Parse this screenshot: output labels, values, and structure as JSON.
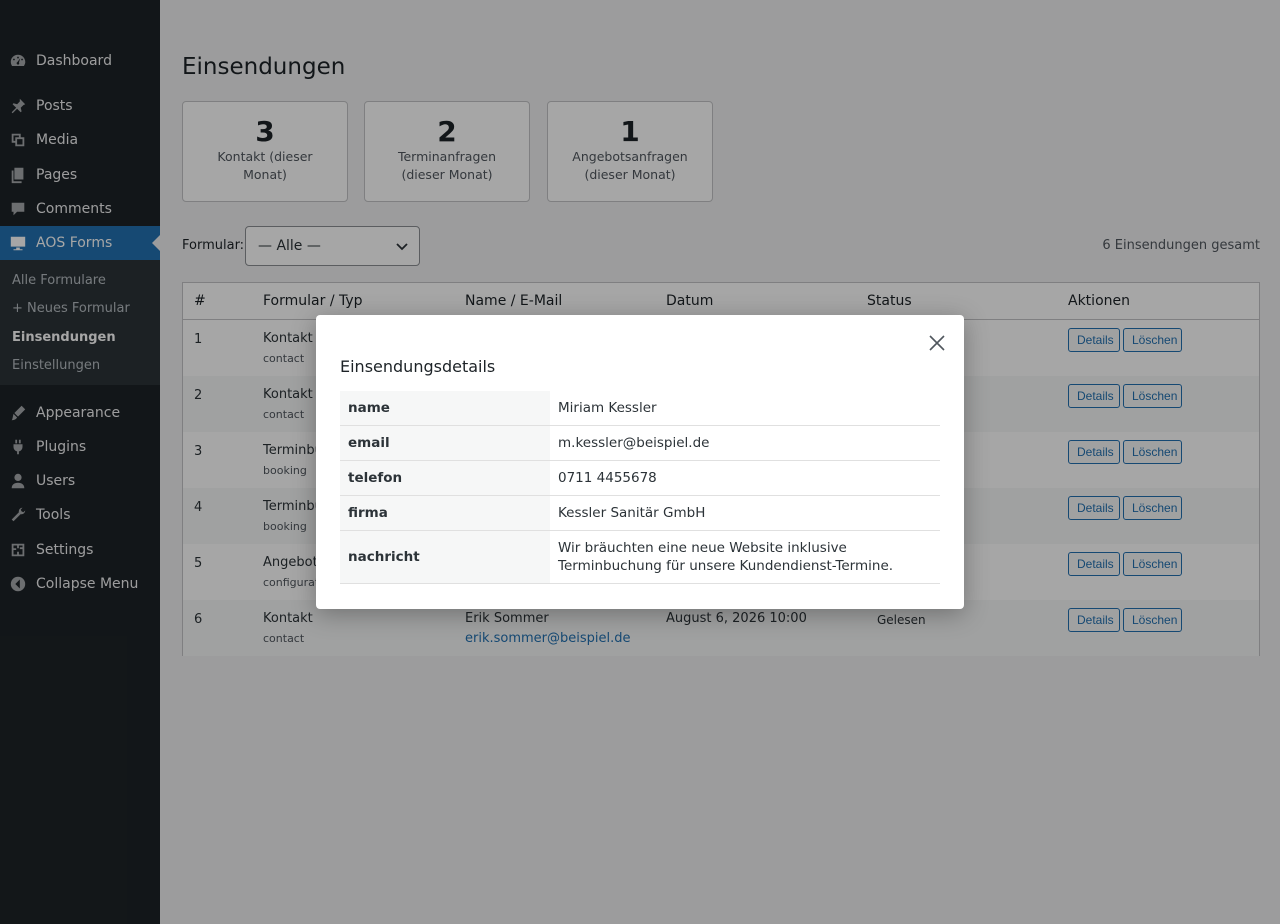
{
  "sidebar": {
    "items": [
      {
        "label": "Dashboard",
        "icon": "dashboard-icon"
      },
      {
        "label": "Posts",
        "icon": "pin-icon"
      },
      {
        "label": "Media",
        "icon": "media-icon"
      },
      {
        "label": "Pages",
        "icon": "pages-icon"
      },
      {
        "label": "Comments",
        "icon": "comments-icon"
      },
      {
        "label": "AOS Forms",
        "icon": "forms-icon"
      },
      {
        "label": "Appearance",
        "icon": "appearance-icon"
      },
      {
        "label": "Plugins",
        "icon": "plugins-icon"
      },
      {
        "label": "Users",
        "icon": "users-icon"
      },
      {
        "label": "Tools",
        "icon": "tools-icon"
      },
      {
        "label": "Settings",
        "icon": "settings-icon"
      },
      {
        "label": "Collapse Menu",
        "icon": "collapse-icon"
      }
    ],
    "submenu": [
      {
        "label": "Alle Formulare"
      },
      {
        "label": "+ Neues Formular"
      },
      {
        "label": "Einsendungen"
      },
      {
        "label": "Einstellungen"
      }
    ]
  },
  "page": {
    "title": "Einsendungen",
    "stats": [
      {
        "value": "3",
        "label": "Kontakt (dieser Monat)"
      },
      {
        "value": "2",
        "label": "Terminanfragen (dieser Monat)"
      },
      {
        "value": "1",
        "label": "Angebotsanfragen (dieser Monat)"
      }
    ],
    "filter_label": "Formular:",
    "filter_value": "— Alle —",
    "total": "6 Einsendungen gesamt"
  },
  "table": {
    "headers": [
      "#",
      "Formular / Typ",
      "Name / E-Mail",
      "Datum",
      "Status",
      "Aktionen"
    ],
    "rows": [
      {
        "id": "1",
        "form": "Kontakt",
        "type": "contact",
        "name": "",
        "email": "",
        "date": "",
        "status": ""
      },
      {
        "id": "2",
        "form": "Kontakt",
        "type": "contact",
        "name": "",
        "email": "",
        "date": "",
        "status": ""
      },
      {
        "id": "3",
        "form": "Terminbu",
        "type": "booking",
        "name": "",
        "email": "",
        "date": "",
        "status": ""
      },
      {
        "id": "4",
        "form": "Terminbu",
        "type": "booking",
        "name": "",
        "email": "",
        "date": "",
        "status": ""
      },
      {
        "id": "5",
        "form": "Angebots",
        "type": "configurato",
        "name": "",
        "email": "",
        "date": "",
        "status": ""
      },
      {
        "id": "6",
        "form": "Kontakt",
        "type": "contact",
        "name": "Erik Sommer",
        "email": "erik.sommer@beispiel.de",
        "date": "August 6, 2026 10:00",
        "status": "Gelesen"
      }
    ],
    "details_label": "Details",
    "delete_label": "Löschen"
  },
  "modal": {
    "title": "Einsendungsdetails",
    "fields": [
      {
        "key": "name",
        "value": "Miriam Kessler"
      },
      {
        "key": "email",
        "value": "m.kessler@beispiel.de"
      },
      {
        "key": "telefon",
        "value": "0711 4455678"
      },
      {
        "key": "firma",
        "value": "Kessler Sanitär GmbH"
      },
      {
        "key": "nachricht",
        "value": "Wir bräuchten eine neue Website inklusive Terminbuchung für unsere Kundendienst-Termine."
      }
    ]
  },
  "colors": {
    "sidebar_bg": "#1d2327",
    "submenu_bg": "#2c3338",
    "accent": "#2271b1"
  }
}
